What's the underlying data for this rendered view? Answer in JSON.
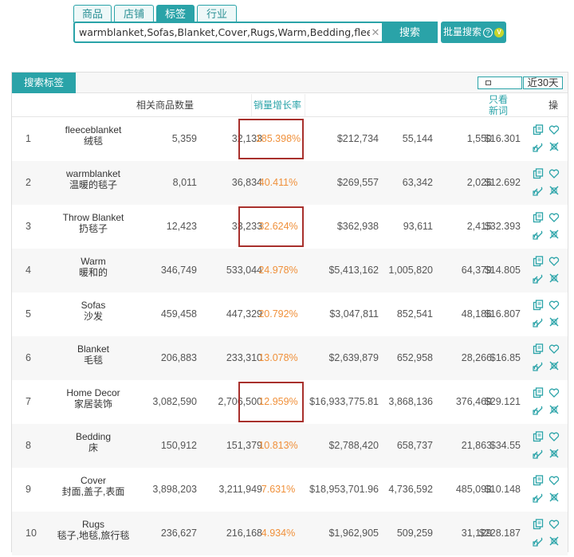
{
  "tabs": [
    {
      "label": "商品",
      "active": false
    },
    {
      "label": "店铺",
      "active": false
    },
    {
      "label": "标签",
      "active": true
    },
    {
      "label": "行业",
      "active": false
    }
  ],
  "search": {
    "value": "warmblanket,Sofas,Blanket,Cover,Rugs,Warm,Bedding,fleeceblanket",
    "button_label": "搜索"
  },
  "batch_search": {
    "label": "批量搜索",
    "help_icon": "?",
    "vip_icon": "V"
  },
  "panel": {
    "title": "搜索标签",
    "period_label": "近30天",
    "columns": {
      "related_count": "相关商品数量",
      "sales_growth": "销量增长率",
      "new_only_line1": "只看",
      "new_only_line2": "新词",
      "actions": "操"
    }
  },
  "colors": {
    "accent": "#2aa3a8",
    "growth_text": "#f0903a",
    "highlight_box": "#a8302c"
  },
  "rows": [
    {
      "idx": "1",
      "en": "fleeceblanket",
      "cn": "绒毯",
      "n1": "5,359",
      "n2": "32,133",
      "growth": "185.398%",
      "sales": "$212,734",
      "n3": "55,144",
      "n4": "1,550",
      "price": "$16.301",
      "highlighted": true
    },
    {
      "idx": "2",
      "en": "warmblanket",
      "cn": "温暖的毯子",
      "n1": "8,011",
      "n2": "36,834",
      "growth": "40.411%",
      "sales": "$269,557",
      "n3": "63,342",
      "n4": "2,026",
      "price": "$12.692",
      "highlighted": false
    },
    {
      "idx": "3",
      "en": "Throw Blanket",
      "cn": "扔毯子",
      "n1": "12,423",
      "n2": "33,233",
      "growth": "32.624%",
      "sales": "$362,938",
      "n3": "93,611",
      "n4": "2,415",
      "price": "$32.393",
      "highlighted": true
    },
    {
      "idx": "4",
      "en": "Warm",
      "cn": "暖和的",
      "n1": "346,749",
      "n2": "533,044",
      "growth": "24.978%",
      "sales": "$5,413,162",
      "n3": "1,005,820",
      "n4": "64,379",
      "price": "$14.805",
      "highlighted": false
    },
    {
      "idx": "5",
      "en": "Sofas",
      "cn": "沙发",
      "n1": "459,458",
      "n2": "447,329",
      "growth": "20.792%",
      "sales": "$3,047,811",
      "n3": "852,541",
      "n4": "48,186",
      "price": "$16.807",
      "highlighted": false
    },
    {
      "idx": "6",
      "en": "Blanket",
      "cn": "毛毯",
      "n1": "206,883",
      "n2": "233,310",
      "growth": "13.078%",
      "sales": "$2,639,879",
      "n3": "652,958",
      "n4": "28,266",
      "price": "$16.85",
      "highlighted": false
    },
    {
      "idx": "7",
      "en": "Home Decor",
      "cn": "家居装饰",
      "n1": "3,082,590",
      "n2": "2,706,500",
      "growth": "12.959%",
      "sales": "$16,933,775.81",
      "n3": "3,868,136",
      "n4": "376,469",
      "price": "$29.121",
      "highlighted": true
    },
    {
      "idx": "8",
      "en": "Bedding",
      "cn": "床",
      "n1": "150,912",
      "n2": "151,379",
      "growth": "10.813%",
      "sales": "$2,788,420",
      "n3": "658,737",
      "n4": "21,863",
      "price": "$34.55",
      "highlighted": false
    },
    {
      "idx": "9",
      "en": "Cover",
      "cn": "封面,盖子,表面",
      "n1": "3,898,203",
      "n2": "3,211,949",
      "growth": "7.631%",
      "sales": "$18,953,701.96",
      "n3": "4,736,592",
      "n4": "485,093",
      "price": "$10.148",
      "highlighted": false
    },
    {
      "idx": "10",
      "en": "Rugs",
      "cn": "毯子,地毯,旅行毯",
      "n1": "236,627",
      "n2": "216,168",
      "growth": "4.934%",
      "sales": "$1,962,905",
      "n3": "509,259",
      "n4": "31,129",
      "price": "$228.187",
      "highlighted": false
    }
  ]
}
